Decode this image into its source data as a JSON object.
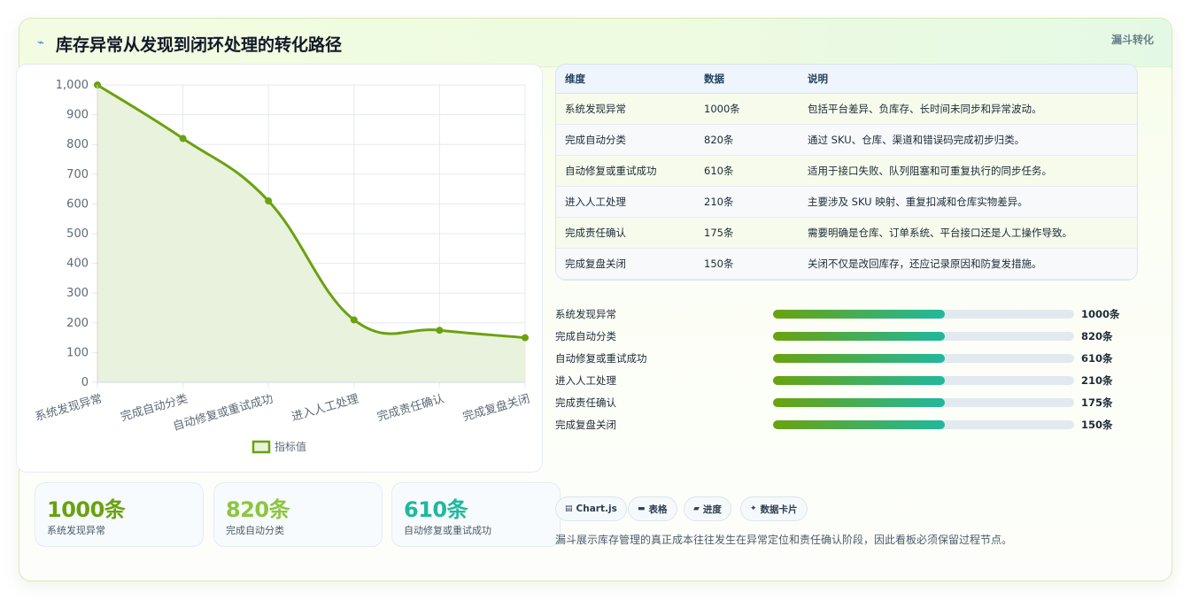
{
  "header": {
    "title_icon": "line-chart-icon",
    "title": "库存异常从发现到闭环处理的转化路径",
    "tag": "漏斗转化"
  },
  "colors": {
    "accent_green": "#6aa20f",
    "accent_lime": "#8cc63f",
    "accent_teal": "#20b89e",
    "area_fill": "#e9f2dc"
  },
  "chart_data": {
    "type": "line",
    "categories": [
      "系统发现异常",
      "完成自动分类",
      "自动修复或重试成功",
      "进入人工处理",
      "完成责任确认",
      "完成复盘关闭"
    ],
    "series": [
      {
        "name": "指标值",
        "values": [
          1000,
          820,
          610,
          210,
          175,
          150
        ],
        "color": "#6aa20f",
        "fill": "area"
      }
    ],
    "ylim": [
      0,
      1000
    ],
    "yticks": [
      0,
      100,
      200,
      300,
      400,
      500,
      600,
      700,
      800,
      900,
      1000
    ],
    "ytick_labels": [
      "0",
      "100",
      "200",
      "300",
      "400",
      "500",
      "600",
      "700",
      "800",
      "900",
      "1,000"
    ],
    "grid": true,
    "legend": "bottom",
    "xlabel": "",
    "ylabel": ""
  },
  "stats": [
    {
      "value": "1000条",
      "label": "系统发现异常",
      "color": "#6aa20f"
    },
    {
      "value": "820条",
      "label": "完成自动分类",
      "color": "#8cc63f"
    },
    {
      "value": "610条",
      "label": "自动修复或重试成功",
      "color": "#20b89e"
    }
  ],
  "table": {
    "headers": [
      "维度",
      "数据",
      "说明"
    ],
    "rows": [
      [
        "系统发现异常",
        "1000条",
        "包括平台差异、负库存、长时间未同步和异常波动。"
      ],
      [
        "完成自动分类",
        "820条",
        "通过 SKU、仓库、渠道和错误码完成初步归类。"
      ],
      [
        "自动修复或重试成功",
        "610条",
        "适用于接口失败、队列阻塞和可重复执行的同步任务。"
      ],
      [
        "进入人工处理",
        "210条",
        "主要涉及 SKU 映射、重复扣减和仓库实物差异。"
      ],
      [
        "完成责任确认",
        "175条",
        "需要明确是仓库、订单系统、平台接口还是人工操作导致。"
      ],
      [
        "完成复盘关闭",
        "150条",
        "关闭不仅是改回库存，还应记录原因和防复发措施。"
      ]
    ]
  },
  "progress": [
    {
      "label": "系统发现异常",
      "value": "1000条",
      "fill_fraction": 0.57
    },
    {
      "label": "完成自动分类",
      "value": "820条",
      "fill_fraction": 0.57
    },
    {
      "label": "自动修复或重试成功",
      "value": "610条",
      "fill_fraction": 0.57
    },
    {
      "label": "进入人工处理",
      "value": "210条",
      "fill_fraction": 0.57
    },
    {
      "label": "完成责任确认",
      "value": "175条",
      "fill_fraction": 0.57
    },
    {
      "label": "完成复盘关闭",
      "value": "150条",
      "fill_fraction": 0.57
    }
  ],
  "chips": [
    {
      "icon": "chart-icon",
      "glyph": "▤",
      "label": "Chart.js"
    },
    {
      "icon": "table-icon",
      "glyph": "▬",
      "label": "表格"
    },
    {
      "icon": "progress-icon",
      "glyph": "▰",
      "label": "进度"
    },
    {
      "icon": "sparkle-icon",
      "glyph": "✦",
      "label": "数据卡片"
    }
  ],
  "footnote": "漏斗展示库存管理的真正成本往往发生在异常定位和责任确认阶段，因此看板必须保留过程节点。"
}
